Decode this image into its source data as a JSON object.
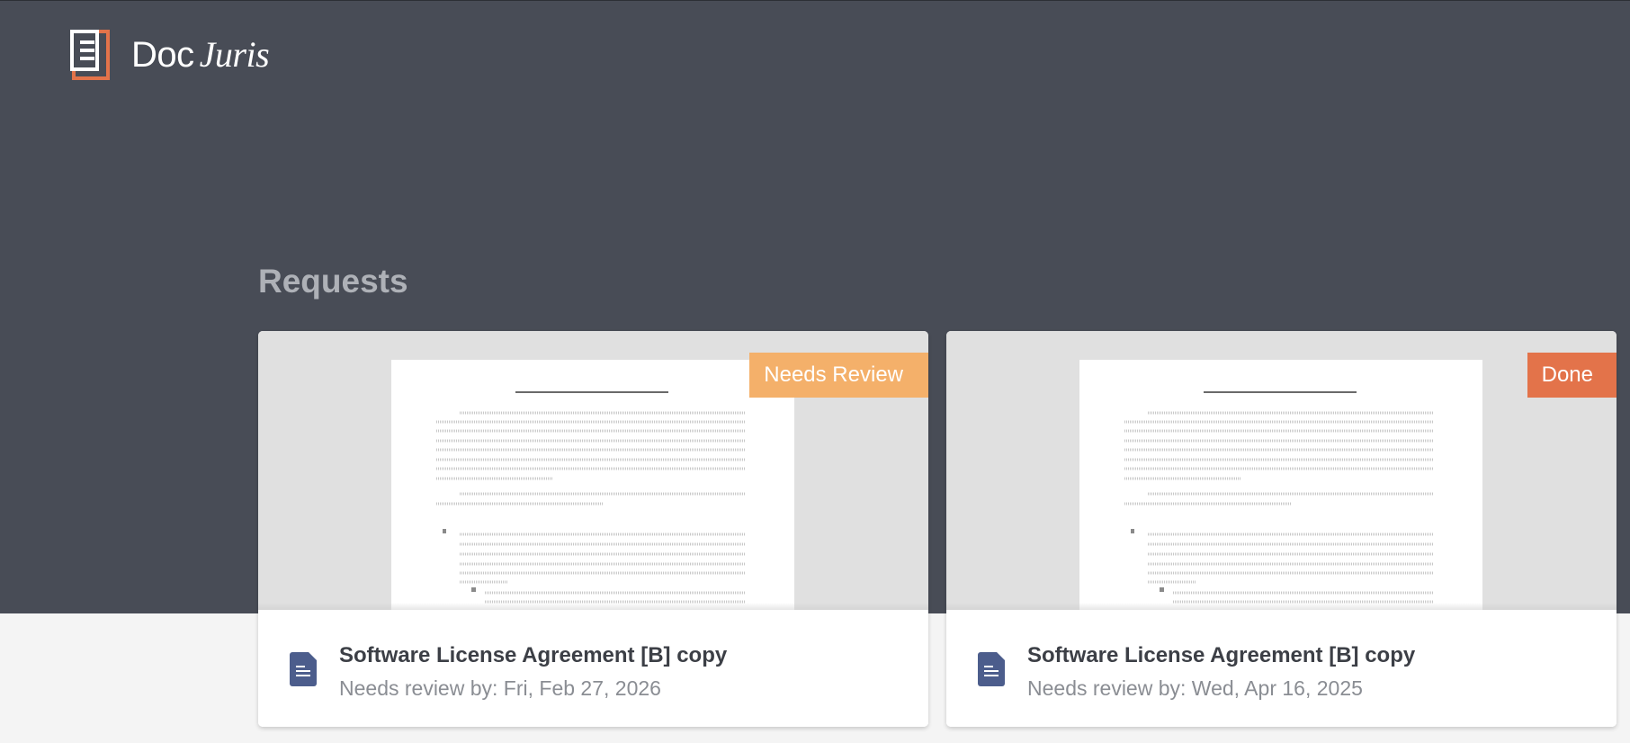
{
  "brand": {
    "name_part1": "Doc",
    "name_part2": "Juris",
    "accent_color": "#e3734a"
  },
  "page": {
    "section_title": "Requests"
  },
  "requests": [
    {
      "title": "Software License Agreement [B] copy",
      "due_label": "Needs review by: Fri, Feb 27, 2026",
      "status": "Needs Review",
      "status_color": "#f4b06a",
      "icon": "document-icon"
    },
    {
      "title": "Software License Agreement [B] copy",
      "due_label": "Needs review by: Wed, Apr 16, 2025",
      "status": "Done",
      "status_color": "#e3734a",
      "icon": "document-icon"
    }
  ]
}
